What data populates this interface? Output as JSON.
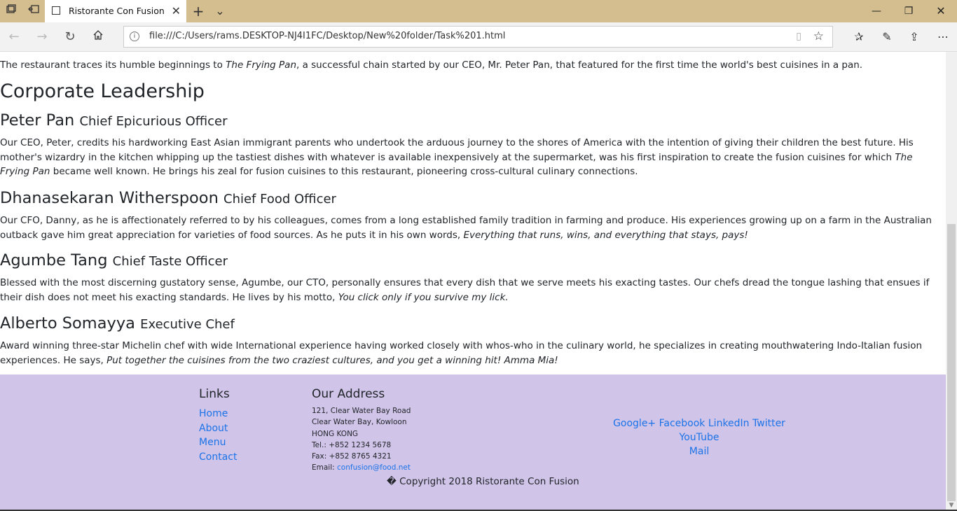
{
  "browser": {
    "tab_title": "Ristorante Con Fusion: A",
    "url": "file:///C:/Users/rams.DESKTOP-NJ4I1FC/Desktop/New%20folder/Task%201.html",
    "new_tab_symbol": "+",
    "tab_list_symbol": "⌄"
  },
  "page": {
    "intro": {
      "pre": "The restaurant traces its humble beginnings to ",
      "em": "The Frying Pan",
      "post": ", a successful chain started by our CEO, Mr. Peter Pan, that featured for the first time the world's best cuisines in a pan."
    },
    "leadership_heading": "Corporate Leadership",
    "leaders": [
      {
        "name": "Peter Pan",
        "role": "Chief Epicurious Officer",
        "text_pre": "Our CEO, Peter, credits his hardworking East Asian immigrant parents who undertook the arduous journey to the shores of America with the intention of giving their children the best future. His mother's wizardry in the kitchen whipping up the tastiest dishes with whatever is available inexpensively at the supermarket, was his first inspiration to create the fusion cuisines for which ",
        "text_em": "The Frying Pan",
        "text_post": " became well known. He brings his zeal for fusion cuisines to this restaurant, pioneering cross-cultural culinary connections."
      },
      {
        "name": "Dhanasekaran Witherspoon",
        "role": "Chief Food Officer",
        "text_pre": "Our CFO, Danny, as he is affectionately referred to by his colleagues, comes from a long established family tradition in farming and produce. His experiences growing up on a farm in the Australian outback gave him great appreciation for varieties of food sources. As he puts it in his own words, ",
        "text_em": "Everything that runs, wins, and everything that stays, pays!",
        "text_post": ""
      },
      {
        "name": "Agumbe Tang",
        "role": "Chief Taste Officer",
        "text_pre": "Blessed with the most discerning gustatory sense, Agumbe, our CTO, personally ensures that every dish that we serve meets his exacting tastes. Our chefs dread the tongue lashing that ensues if their dish does not meet his exacting standards. He lives by his motto, ",
        "text_em": "You click only if you survive my lick.",
        "text_post": ""
      },
      {
        "name": "Alberto Somayya",
        "role": "Executive Chef",
        "text_pre": "Award winning three-star Michelin chef with wide International experience having worked closely with whos-who in the culinary world, he specializes in creating mouthwatering Indo-Italian fusion experiences. He says, ",
        "text_em": "Put together the cuisines from the two craziest cultures, and you get a winning hit! Amma Mia!",
        "text_post": ""
      }
    ]
  },
  "footer": {
    "links_heading": "Links",
    "links": [
      "Home",
      "About",
      "Menu",
      "Contact"
    ],
    "address_heading": "Our Address",
    "address_lines": [
      "121, Clear Water Bay Road",
      "Clear Water Bay, Kowloon",
      "HONG KONG",
      "Tel.: +852 1234 5678",
      "Fax: +852 8765 4321"
    ],
    "email_label": "Email: ",
    "email": "confusion@food.net",
    "social": [
      "Google+",
      "Facebook",
      "LinkedIn",
      "Twitter",
      "YouTube"
    ],
    "mail": "Mail",
    "copyright": "� Copyright 2018 Ristorante Con Fusion"
  },
  "colors": {
    "tabbar": "#d4bd8e",
    "footer_bg": "#d1c4e9",
    "link": "#1a73e8"
  }
}
